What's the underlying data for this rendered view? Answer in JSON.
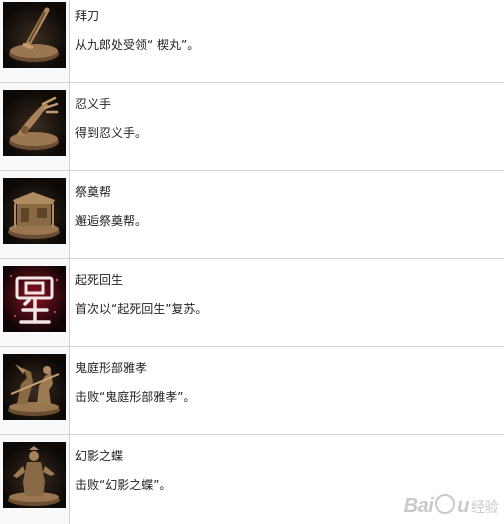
{
  "achievements": [
    {
      "title": "拜刀",
      "description": "从九郎处受领“ 楔丸”。",
      "icon": "kusabimaru-sword-icon"
    },
    {
      "title": "忍义手",
      "description": "得到忍义手。",
      "icon": "shinobi-prosthetic-icon"
    },
    {
      "title": "祭奠帮",
      "description": "邂逅祭奠帮。",
      "icon": "memorial-mob-stall-icon"
    },
    {
      "title": "起死回生",
      "description": "首次以“起死回生”复苏。",
      "icon": "resurrection-kanji-icon"
    },
    {
      "title": "鬼庭形部雅孝",
      "description": "击败“鬼庭形部雅孝”。",
      "icon": "gyoubu-oniwa-statue-icon"
    },
    {
      "title": "幻影之蝶",
      "description": "击败“幻影之蝶”。",
      "icon": "lady-butterfly-statue-icon"
    }
  ],
  "watermark": {
    "brand": "Baidu",
    "sub": "经验"
  },
  "colors": {
    "row_border": "#d0d0d0",
    "thumb_bg": "#0c0907",
    "statue": "#8a6a44",
    "resurrection_red": "#b0182a"
  }
}
